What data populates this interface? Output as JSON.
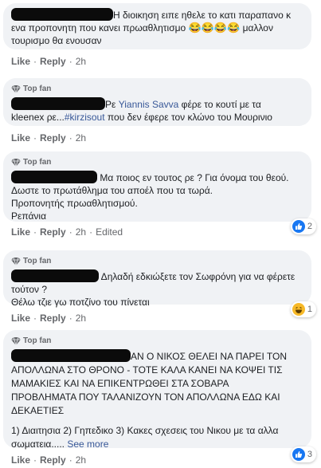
{
  "comments": [
    {
      "text_a": "Η διοικηση ειπε ηθελε το κατι παραπανο κ",
      "text_b": "ενα προπονητη που κανει πρωαθλητισμο",
      "emojis": "😂😂😂😂",
      "text_c": "μαλλον",
      "text_d": "τουρισμο θα ενουσαν",
      "like": "Like",
      "reply": "Reply",
      "time": "2h"
    },
    {
      "top_fan": "Top fan",
      "text_a": "Ρε",
      "mention": "Yiannis Savva",
      "text_b": "φέρε το κουτί με τα",
      "text_c": "kleenex ρε...",
      "hashtag": "#kirzisout",
      "text_d": "που δεν έφερε τον κλώνο του Μουρινιο",
      "like": "Like",
      "reply": "Reply",
      "time": "2h"
    },
    {
      "top_fan": "Top fan",
      "text_a": "Μα ποιος εν τουτος ρε ? Για όνομα του θεού.",
      "text_b": "Δωστε το πρωτάθλημα του αποέλ που τα τωρά.",
      "text_c": "Προπονητής πρωαθλητισμού.",
      "text_d": "Ρεπάνια",
      "like": "Like",
      "reply": "Reply",
      "time": "2h",
      "edited": "Edited",
      "reaction_count": "2"
    },
    {
      "top_fan": "Top fan",
      "text_a": "Δηλαδή εδκιώξετε τον Σωφρόνη για να φέρετε",
      "text_b": "τούτον ?",
      "text_c": "Θέλω τζιε γω ποτζίνο του πίνεται",
      "like": "Like",
      "reply": "Reply",
      "time": "2h",
      "reaction_count": "1"
    },
    {
      "top_fan": "Top fan",
      "text_a": "ΑΝ Ο ΝΙΚΟΣ ΘΕΛΕΙ ΝΑ ΠΑΡΕΙ ΤΟΝ",
      "text_b": "ΑΠΟΛΛΩΝΑ ΣΤΟ ΘΡΟΝΟ - ΤΟΤΕ ΚΑΛΑ ΚΑΝΕΙ ΝΑ ΚΟΨΕΙ ΤΙΣ",
      "text_c": "ΜΑΜΑΚΙΕΣ ΚΑΙ ΝΑ ΕΠΙΚΕΝΤΡΩΘΕΙ ΣΤΑ ΣΟΒΑΡΑ",
      "text_d": "ΠΡΟΒΛΗΜΑΤΑ ΠΟΥ ΤΑΛΑΝΙΖΟΥΝ ΤΟΝ ΑΠΟΛΛΩΝΑ ΕΔΩ ΚΑΙ",
      "text_e": "ΔΕΚΑΕΤΙΕΣ",
      "text_f": "1) Διαιτησια 2) Γηπεδικο 3) Κακες σχεσεις του Νικου με τα αλλα",
      "text_g": "σωματεια.....",
      "see_more": "See more",
      "like": "Like",
      "reply": "Reply",
      "time": "2h",
      "reaction_count": "3"
    }
  ],
  "colors": {
    "bubble": "#f0f2f5",
    "link": "#385898",
    "like_blue": "#1877f2",
    "haha_yellow": "#f7b928"
  },
  "icons": [
    "top-fan-diamond-icon",
    "like-reaction-icon",
    "haha-reaction-icon"
  ]
}
